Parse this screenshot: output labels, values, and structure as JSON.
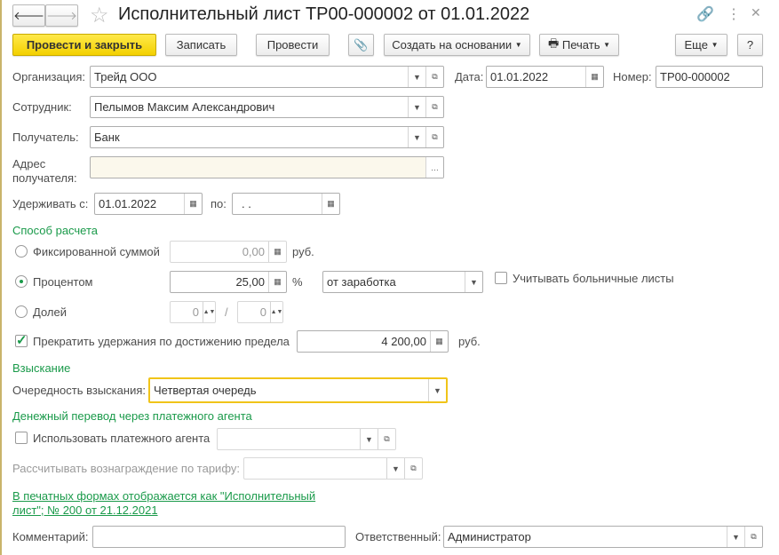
{
  "title": "Исполнительный лист ТР00-000002 от 01.01.2022",
  "toolbar": {
    "post_close": "Провести и закрыть",
    "save": "Записать",
    "post": "Провести",
    "create_based": "Создать на основании",
    "print": "Печать",
    "more": "Еще",
    "help": "?"
  },
  "fields": {
    "org_label": "Организация:",
    "org": "Трейд ООО",
    "date_label": "Дата:",
    "date": "01.01.2022",
    "number_label": "Номер:",
    "number": "ТР00-000002",
    "employee_label": "Сотрудник:",
    "employee": "Пелымов Максим Александрович",
    "recipient_label": "Получатель:",
    "recipient": "Банк",
    "address_label": "Адрес получателя:",
    "address": "",
    "hold_from_label": "Удерживать с:",
    "hold_from": "01.01.2022",
    "hold_to_label": "по:",
    "hold_to": " .  ."
  },
  "calc": {
    "title": "Способ расчета",
    "fixed_label": "Фиксированной суммой",
    "fixed_value": "0,00",
    "rub": "руб.",
    "percent_label": "Процентом",
    "percent_value": "25,00",
    "percent_sign": "%",
    "percent_base": "от заработка",
    "sick_label": "Учитывать больничные листы",
    "share_label": "Долей",
    "share_num": "0",
    "share_sep": "/",
    "share_den": "0",
    "limit_label": "Прекратить удержания по достижению предела",
    "limit_value": "4 200,00"
  },
  "collection": {
    "title": "Взыскание",
    "priority_label": "Очередность взыскания:",
    "priority": "Четвертая очередь"
  },
  "agent": {
    "title": "Денежный перевод через платежного агента",
    "use_label": "Использовать платежного агента",
    "use_value": "",
    "fee_label": "Рассчитывать вознаграждение по тарифу:",
    "fee_value": ""
  },
  "print_link": "В печатных формах отображается как \"Исполнительный лист\"; № 200 от 21.12.2021",
  "comment_label": "Комментарий:",
  "comment": "",
  "responsible_label": "Ответственный:",
  "responsible": "Администратор"
}
